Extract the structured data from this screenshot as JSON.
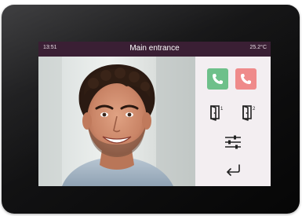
{
  "status_bar": {
    "time": "13:51",
    "title": "Main entrance",
    "temperature": "25.2°C"
  },
  "controls": {
    "door_1_index": "1",
    "door_2_index": "2"
  },
  "colors": {
    "status_bar": "#3a1f34",
    "accept_call": "#6ec08a",
    "reject_call": "#ef8a8a",
    "icon_dark": "#222222"
  },
  "icons": [
    "accept-call-icon",
    "reject-call-icon",
    "door-1-icon",
    "door-2-icon",
    "settings-sliders-icon",
    "back-return-icon"
  ]
}
